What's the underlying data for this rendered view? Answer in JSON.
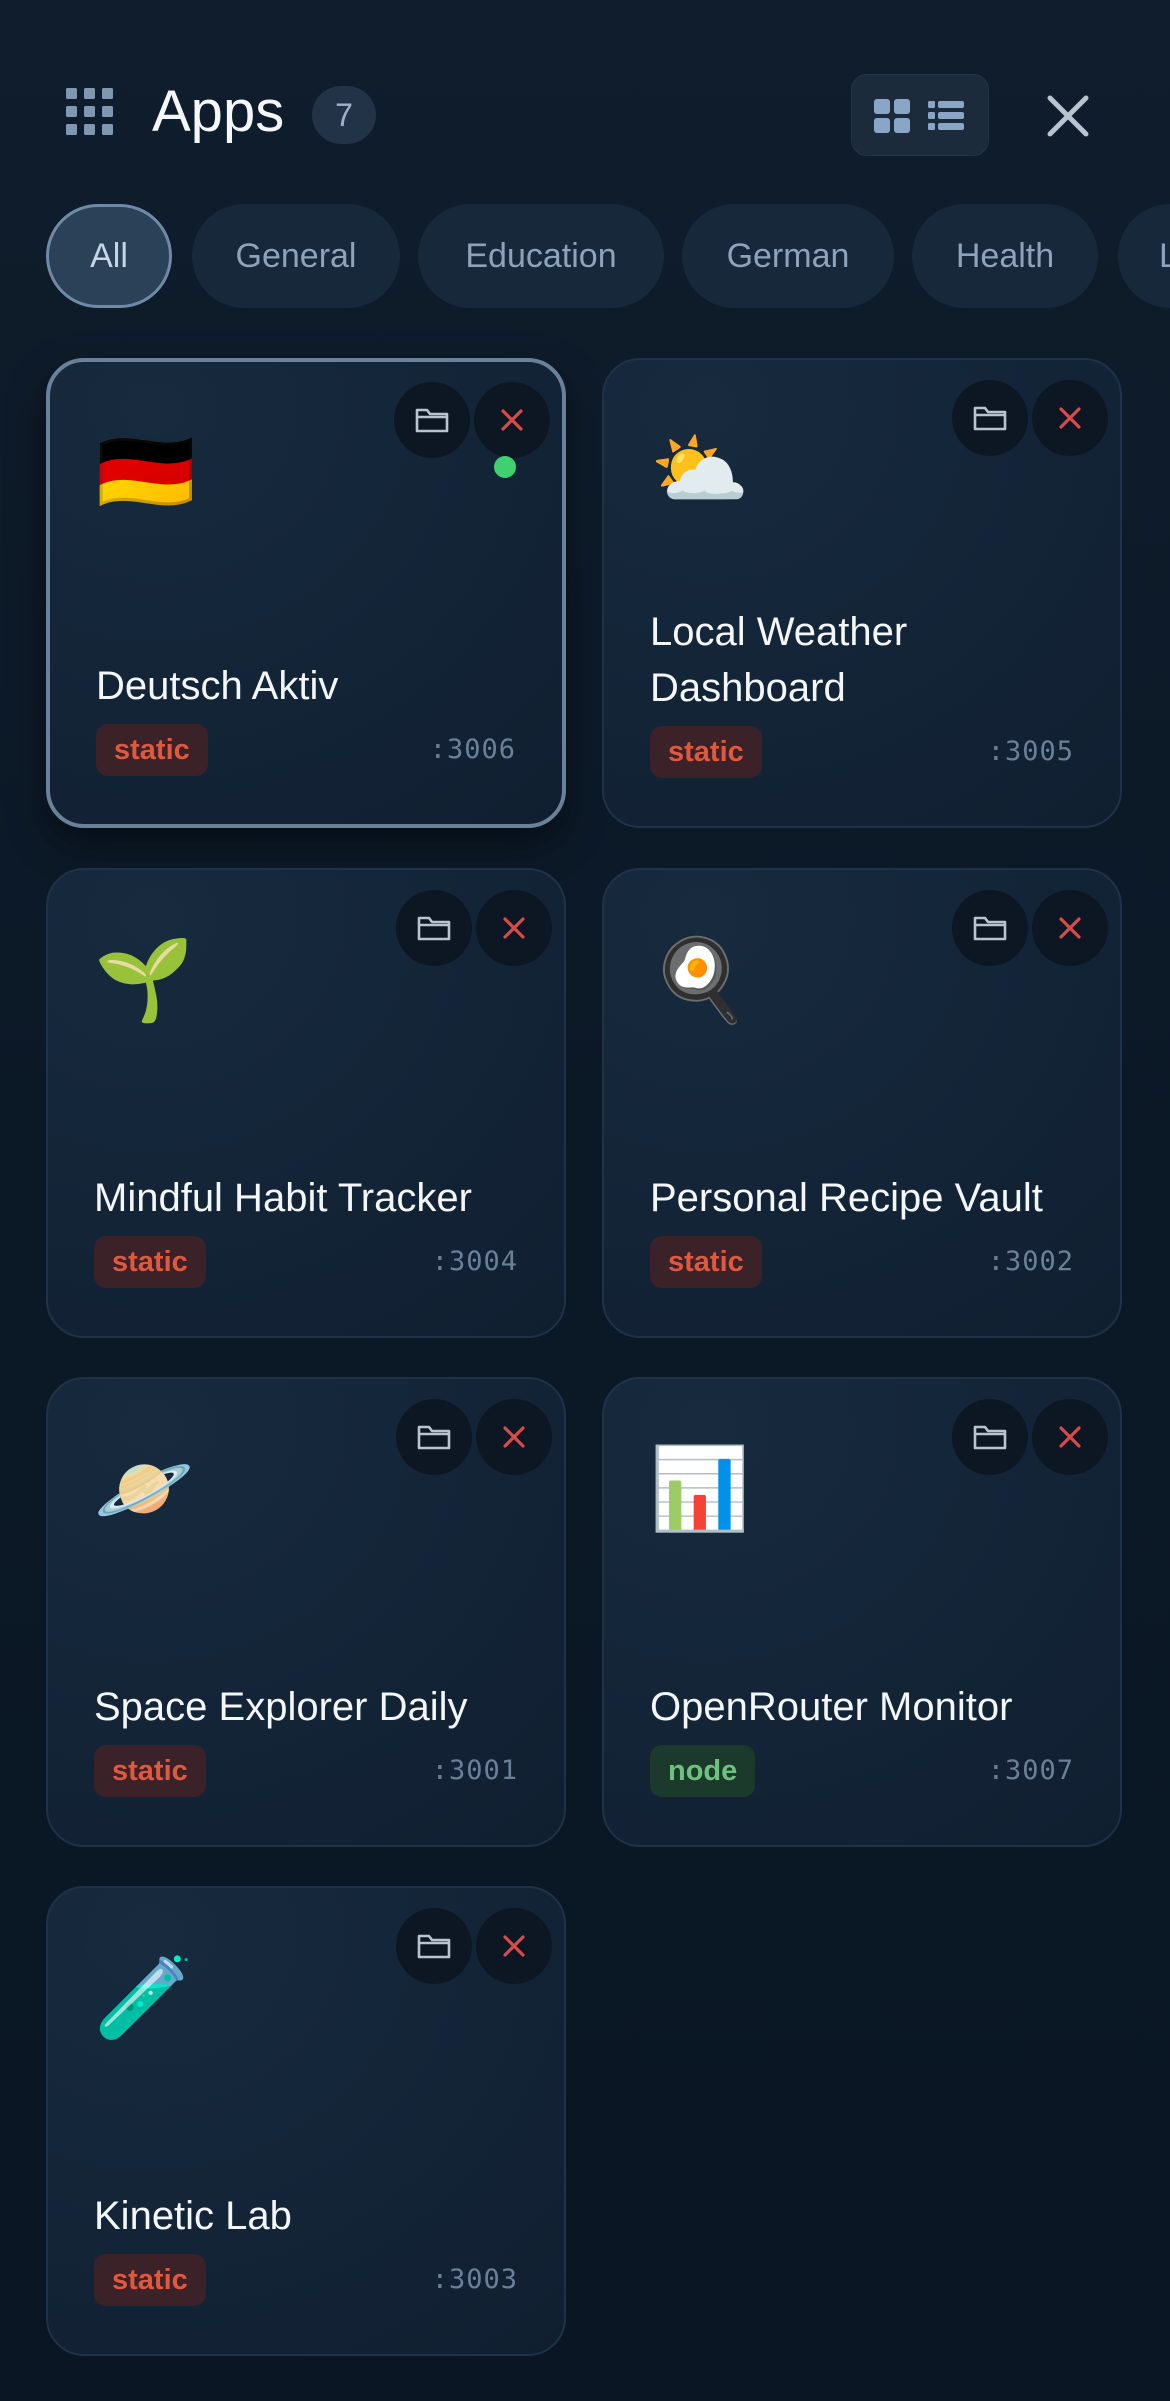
{
  "header": {
    "title": "Apps",
    "count": "7",
    "icons": {
      "menu": "grid-icon",
      "grid_view": "grid-view-icon",
      "list_view": "list-view-icon",
      "close": "close-icon"
    }
  },
  "filters": [
    "All",
    "General",
    "Education",
    "German",
    "Health",
    "L"
  ],
  "active_filter": "All",
  "apps": [
    {
      "emoji": "🇩🇪",
      "name": "Deutsch Aktiv",
      "type": "static",
      "port": ":3006",
      "running": true
    },
    {
      "emoji": "⛅",
      "name": "Local Weather Dashboard",
      "type": "static",
      "port": ":3005",
      "running": false
    },
    {
      "emoji": "🌱",
      "name": "Mindful Habit Tracker",
      "type": "static",
      "port": ":3004",
      "running": false
    },
    {
      "emoji": "🍳",
      "name": "Personal Recipe Vault",
      "type": "static",
      "port": ":3002",
      "running": false
    },
    {
      "emoji": "🪐",
      "name": "Space Explorer Daily",
      "type": "static",
      "port": ":3001",
      "running": false
    },
    {
      "emoji": "📊",
      "name": "OpenRouter Monitor",
      "type": "node",
      "port": ":3007",
      "running": false
    },
    {
      "emoji": "🧪",
      "name": "Kinetic Lab",
      "type": "static",
      "port": ":3003",
      "running": false
    }
  ],
  "colors": {
    "background": "#0b1826",
    "card": "#132437",
    "static_tag": "#e0583e",
    "node_tag": "#6fc27d",
    "running_dot": "#3fd16f",
    "delete_icon": "#d94a4a"
  }
}
